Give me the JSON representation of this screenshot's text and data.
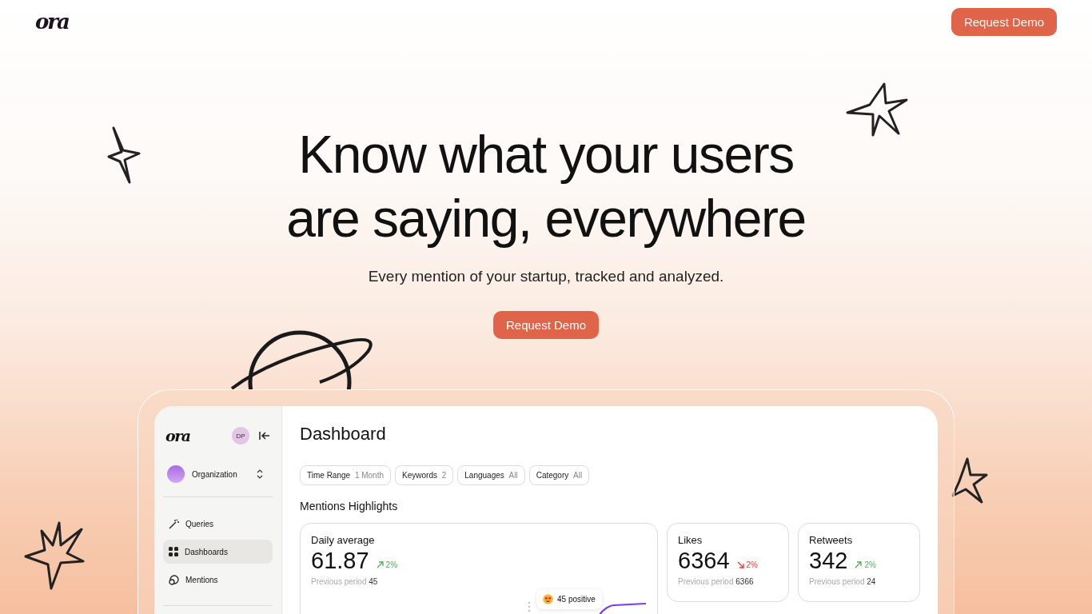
{
  "header": {
    "logo": "ora",
    "button": "Request Demo"
  },
  "hero": {
    "headline": [
      "Know what your users",
      "are saying, everywhere"
    ],
    "subtitle": "Every mention of your startup, tracked and analyzed.",
    "button": "Request Demo"
  },
  "dashboard": {
    "sidebar": {
      "logo": "ora",
      "avatar": "DP",
      "organization": "Organization",
      "items": [
        {
          "label": "Queries",
          "kind": "wand",
          "selected": false
        },
        {
          "label": "Dashboards",
          "kind": "grid",
          "selected": true
        },
        {
          "label": "Mentions",
          "kind": "chat",
          "selected": false
        }
      ]
    },
    "title": "Dashboard",
    "filters": [
      {
        "label": "Time Range",
        "value": "1 Month"
      },
      {
        "label": "Keywords",
        "value": "2"
      },
      {
        "label": "Languages",
        "value": "All"
      },
      {
        "label": "Category",
        "value": "All"
      }
    ],
    "section": "Mentions Highlights",
    "cards": [
      {
        "kind": "chart",
        "label": "Daily average",
        "value": "61.87",
        "increase": true,
        "change": "2%",
        "previous_label": "Previous period",
        "previous": "45",
        "tooltip": "45 positive"
      },
      {
        "kind": "stat",
        "label": "Likes",
        "value": "6364",
        "increase": false,
        "change": "2%",
        "previous_label": "Previous period",
        "previous": "6366"
      },
      {
        "kind": "stat",
        "label": "Retweets",
        "value": "342",
        "increase": true,
        "change": "2%",
        "previous_label": "Previous period",
        "previous": "24"
      }
    ]
  }
}
